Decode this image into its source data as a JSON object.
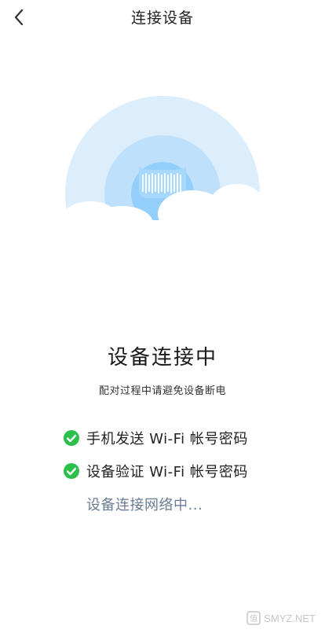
{
  "header": {
    "title": "连接设备",
    "back_icon": "chevron-left-icon"
  },
  "status": {
    "title": "设备连接中",
    "hint": "配对过程中请避免设备断电"
  },
  "steps": [
    {
      "label": "手机发送 Wi-Fi 帐号密码",
      "state": "done",
      "icon": "check-circle-icon"
    },
    {
      "label": "设备验证 Wi-Fi 帐号密码",
      "state": "done",
      "icon": "check-circle-icon"
    },
    {
      "label": "设备连接网络中...",
      "state": "pending"
    }
  ],
  "watermark": {
    "text": "SMYZ.NET"
  },
  "colors": {
    "success": "#2bc04a",
    "pending_text": "#6b7d92",
    "ring_outer": "#dcedfb",
    "ring_middle": "#bfe0fa",
    "ring_inner": "#94cffb",
    "cloud": "#ffffff"
  }
}
